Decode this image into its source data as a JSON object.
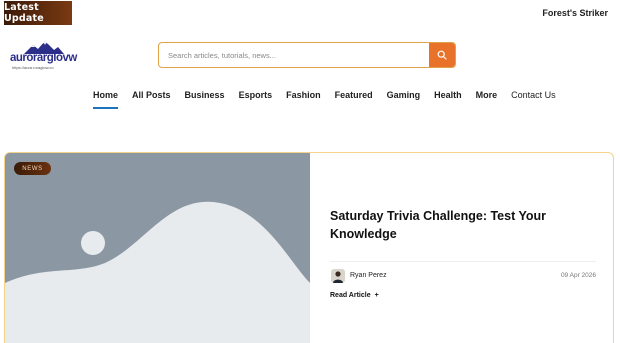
{
  "topbar": {
    "latest_label": "Latest Update",
    "ticker_text": "Forest's Striker"
  },
  "logo": {
    "name": "aurorarglovw",
    "tagline": "https://aura.roraglow.co"
  },
  "search": {
    "placeholder": "Search articles, tutorials, news...",
    "button_icon": "search-icon"
  },
  "nav": {
    "items": [
      {
        "label": "Home"
      },
      {
        "label": "All Posts"
      },
      {
        "label": "Business"
      },
      {
        "label": "Esports"
      },
      {
        "label": "Fashion"
      },
      {
        "label": "Featured"
      },
      {
        "label": "Gaming"
      },
      {
        "label": "Health"
      },
      {
        "label": "More"
      },
      {
        "label": "Contact Us"
      }
    ],
    "active_index": 0
  },
  "featured": {
    "category": "NEWS",
    "title": "Saturday Trivia Challenge: Test Your Knowledge",
    "author": "Ryan Perez",
    "date": "09 Apr 2026",
    "read_more": "Read Article",
    "read_more_icon": "plus-icon",
    "image_icon": "image-placeholder-icon"
  },
  "colors": {
    "accent": "#e8722a",
    "badge_dark": "#3a1a08",
    "active_underline": "#1e73be",
    "card_border": "#f3d28a",
    "logo_blue": "#2b2f8a"
  }
}
